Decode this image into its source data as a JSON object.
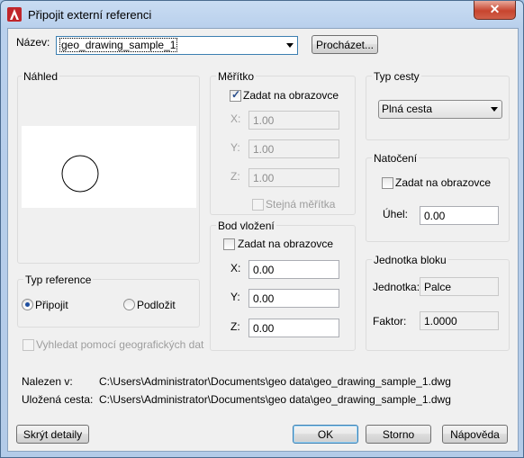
{
  "window": {
    "title": "Připojit externí referenci",
    "close_glyph": "✕"
  },
  "name": {
    "label": "Název:",
    "value": "geo_drawing_sample_1",
    "browse_label": "Procházet..."
  },
  "preview": {
    "label": "Náhled"
  },
  "scale": {
    "label": "Měřítko",
    "specify_on_screen": "Zadat na obrazovce",
    "x_label": "X:",
    "x_value": "1.00",
    "y_label": "Y:",
    "y_value": "1.00",
    "z_label": "Z:",
    "z_value": "1.00",
    "uniform_label": "Stejná měřítka"
  },
  "insertion": {
    "label": "Bod vložení",
    "specify_on_screen": "Zadat na obrazovce",
    "x_label": "X:",
    "x_value": "0.00",
    "y_label": "Y:",
    "y_value": "0.00",
    "z_label": "Z:",
    "z_value": "0.00"
  },
  "path_type": {
    "label": "Typ cesty",
    "value": "Plná cesta"
  },
  "rotation": {
    "label": "Natočení",
    "specify_on_screen": "Zadat na obrazovce",
    "angle_label": "Úhel:",
    "angle_value": "0.00"
  },
  "block_unit": {
    "label": "Jednotka bloku",
    "unit_label": "Jednotka:",
    "unit_value": "Palce",
    "factor_label": "Faktor:",
    "factor_value": "1.0000"
  },
  "reference_type": {
    "label": "Typ reference",
    "attach": "Připojit",
    "overlay": "Podložit"
  },
  "geo_locate": "Vyhledat pomocí geografických dat",
  "found_in": {
    "label": "Nalezen v:",
    "value": "C:\\Users\\Administrator\\Documents\\geo data\\geo_drawing_sample_1.dwg"
  },
  "saved_path": {
    "label": "Uložená cesta:",
    "value": "C:\\Users\\Administrator\\Documents\\geo data\\geo_drawing_sample_1.dwg"
  },
  "buttons": {
    "hide_details": "Skrýt detaily",
    "ok": "OK",
    "cancel": "Storno",
    "help": "Nápověda"
  }
}
